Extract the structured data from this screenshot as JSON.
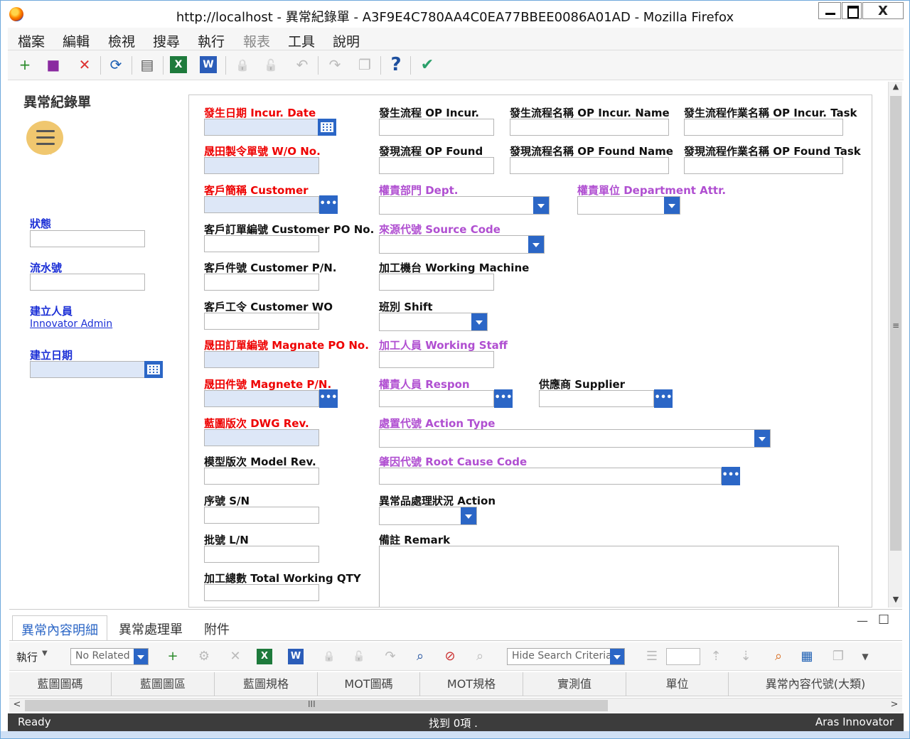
{
  "window": {
    "title": "http://localhost - 異常紀錄單 - A3F9E4C780AA4C0EA77BBEE0086A01AD - Mozilla Firefox",
    "close_glyph": "X"
  },
  "menu": [
    "檔案",
    "編輯",
    "檢視",
    "搜尋",
    "執行",
    "報表",
    "工具",
    "說明"
  ],
  "toolbar_icons": [
    "new-icon",
    "save-icon",
    "discard-icon",
    "refresh-icon",
    "print-icon",
    "excel-icon",
    "word-icon",
    "lock-icon",
    "unlock-icon",
    "undo-icon",
    "promote-icon",
    "copy-icon",
    "help-icon",
    "done-icon"
  ],
  "toolbar_glyphs": {
    "new": "+",
    "save": "■",
    "discard": "✕",
    "refresh": "⟳",
    "print": "▤",
    "excel": "X",
    "word": "W",
    "lock": "🔒",
    "unlock": "🔓",
    "undo": "↶",
    "promote": "↷",
    "copy": "❐",
    "help": "?",
    "done": "✔"
  },
  "left_panel": {
    "title": "異常紀錄單",
    "status_label": "狀態",
    "status_value": "",
    "serial_label": "流水號",
    "serial_value": "",
    "created_by_label": "建立人員",
    "created_by_value": "Innovator Admin",
    "created_on_label": "建立日期",
    "created_on_value": ""
  },
  "form": {
    "col1": {
      "incur_date": "發生日期 Incur. Date",
      "wo_no": "晟田製令單號 W/O No.",
      "customer": "客戶簡稱 Customer",
      "customer_po": "客戶訂單編號 Customer PO No.",
      "customer_pn": "客戶件號 Customer P/N.",
      "customer_wo": "客戶工令 Customer WO",
      "magnate_po": "晟田訂單編號 Magnate PO No.",
      "magnete_pn": "晟田件號 Magnete P/N.",
      "dwg_rev": "藍圖版次 DWG Rev.",
      "model_rev": "模型版次 Model Rev.",
      "sn": "序號 S/N",
      "ln": "批號 L/N",
      "total_qty": "加工總數 Total Working QTY"
    },
    "col2": {
      "op_incur": "發生流程 OP Incur.",
      "op_found": "發現流程 OP Found",
      "dept": "權責部門 Dept.",
      "source_code": "來源代號 Source Code",
      "machine": "加工機台 Working Machine",
      "shift": "班別 Shift",
      "staff": "加工人員 Working Staff",
      "respon": "權責人員 Respon",
      "action_type": "處置代號 Action Type",
      "root_cause": "肇因代號 Root Cause Code",
      "action": "異常品處理狀況 Action",
      "remark": "備註 Remark"
    },
    "col3": {
      "op_incur_name": "發生流程名稱 OP Incur. Name",
      "op_found_name": "發現流程名稱 OP Found Name",
      "dept_attr": "權責單位 Department Attr.",
      "supplier": "供應商 Supplier"
    },
    "col4": {
      "op_incur_task": "發生流程作業名稱 OP Incur. Task",
      "op_found_task": "發現流程作業名稱 OP Found Task"
    },
    "dots_glyph": "•••"
  },
  "relationships": {
    "tabs": [
      "異常內容明細",
      "異常處理單",
      "附件"
    ],
    "action_label": "執行",
    "related_select": "No Related",
    "search_select": "Hide Search Criteria",
    "columns": [
      "藍圖圖碼",
      "藍圖圖區",
      "藍圖規格",
      "MOT圖碼",
      "MOT規格",
      "實測值",
      "單位",
      "異常內容代號(大類)"
    ],
    "panel_min_glyph": "—",
    "panel_max_glyph": "☐"
  },
  "status": {
    "left": "Ready",
    "center": "找到 0項 .",
    "right": "Aras Innovator"
  },
  "colors": {
    "required_field": "#dde7f7",
    "button_blue": "#2b66c6",
    "label_red": "#e00000",
    "label_purple": "#b04fd1",
    "label_blue": "#1b2fd6",
    "status_bar": "#3c3c3c"
  }
}
